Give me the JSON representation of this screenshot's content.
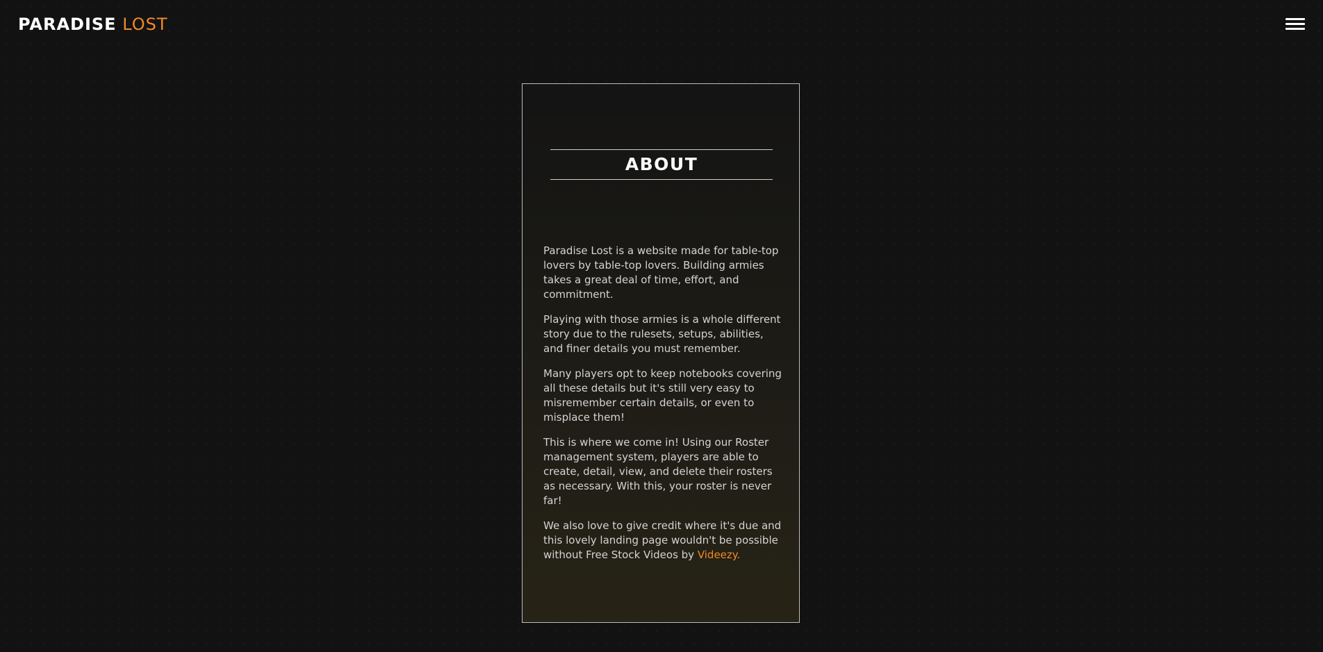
{
  "nav": {
    "brand_part1": "PARADISE",
    "brand_part2": "LOST",
    "menu_icon": "hamburger-menu-icon"
  },
  "about": {
    "title": "ABOUT",
    "paragraphs": [
      "Paradise Lost is a website made for table-top lovers by table-top lovers. Building armies takes a great deal of time, effort, and commitment.",
      "Playing with those armies is a whole different story due to the rulesets, setups, abilities, and finer details you must remember.",
      "Many players opt to keep notebooks covering all these details but it's still very easy to misremember certain details, or even to misplace them!",
      "This is where we come in! Using our Roster management system, players are able to create, detail, view, and delete their rosters as necessary. With this, your roster is never far!"
    ],
    "credit_text": "We also love to give credit where it's due and this lovely landing page wouldn't be possible without Free Stock Videos by ",
    "credit_link": "Videezy",
    "credit_end": "."
  },
  "colors": {
    "background": "#121212",
    "accent": "#f28a26",
    "text": "#d4d4d4",
    "border": "#bdbdbd"
  }
}
